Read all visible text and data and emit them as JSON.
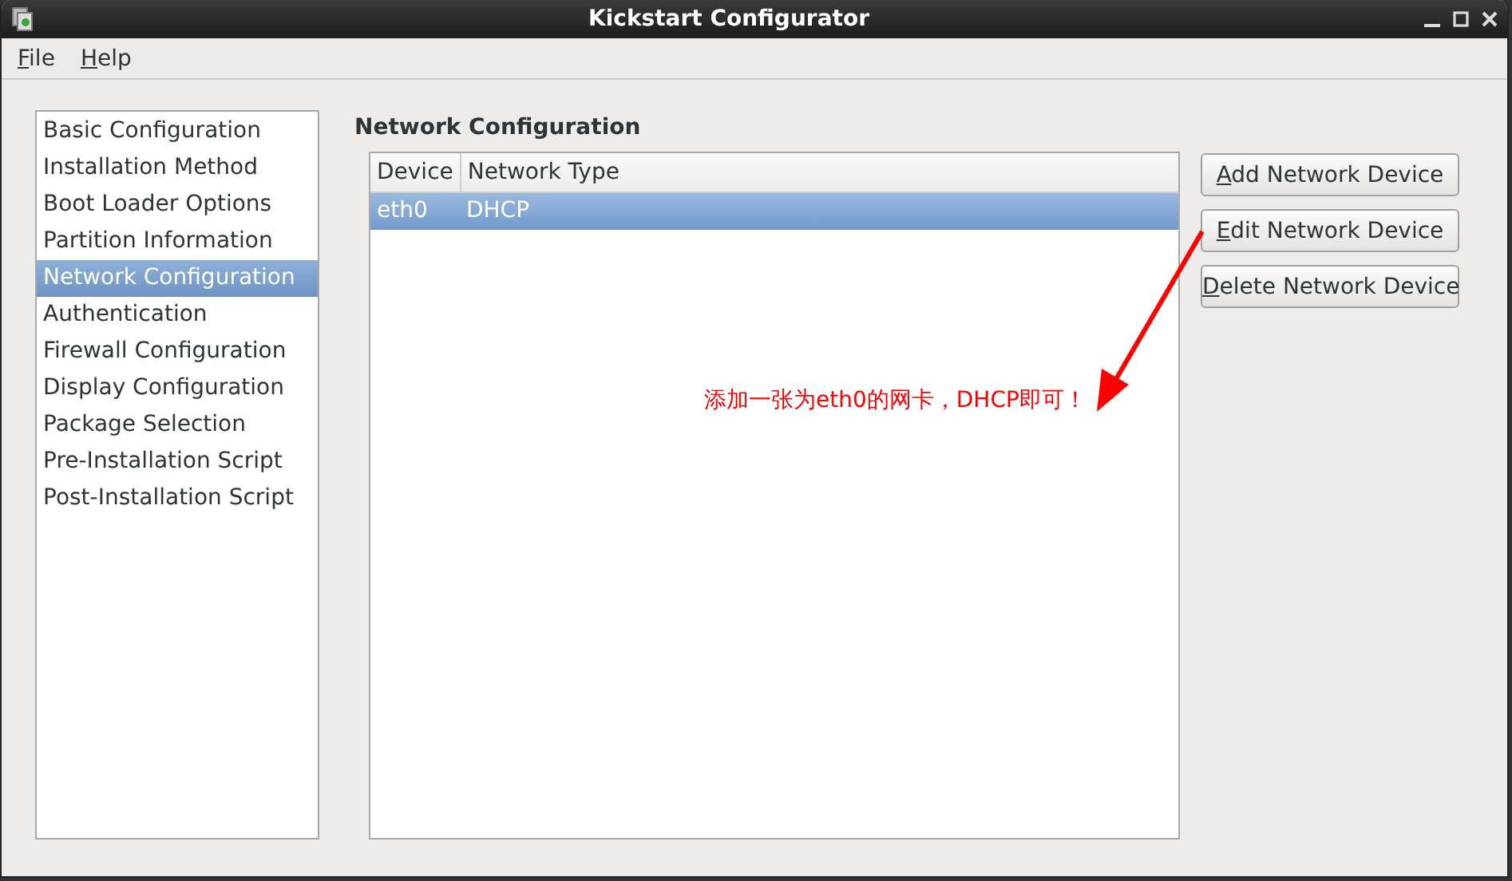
{
  "window": {
    "title": "Kickstart Configurator"
  },
  "menu": [
    "File",
    "Help"
  ],
  "sidebar": {
    "items": [
      {
        "label": "Basic Configuration",
        "selected": false
      },
      {
        "label": "Installation Method",
        "selected": false
      },
      {
        "label": "Boot Loader Options",
        "selected": false
      },
      {
        "label": "Partition Information",
        "selected": false
      },
      {
        "label": "Network Configuration",
        "selected": true
      },
      {
        "label": "Authentication",
        "selected": false
      },
      {
        "label": "Firewall Configuration",
        "selected": false
      },
      {
        "label": "Display Configuration",
        "selected": false
      },
      {
        "label": "Package Selection",
        "selected": false
      },
      {
        "label": "Pre-Installation Script",
        "selected": false
      },
      {
        "label": "Post-Installation Script",
        "selected": false
      }
    ]
  },
  "section_title": "Network Configuration",
  "table": {
    "columns": [
      "Device",
      "Network Type"
    ],
    "rows": [
      {
        "cells": [
          "eth0",
          "DHCP"
        ],
        "selected": true
      }
    ]
  },
  "buttons": [
    "Add Network Device",
    "Edit Network Device",
    "Delete Network Device"
  ],
  "annotation": {
    "text": "添加一张为eth0的网卡，DHCP即可！"
  }
}
